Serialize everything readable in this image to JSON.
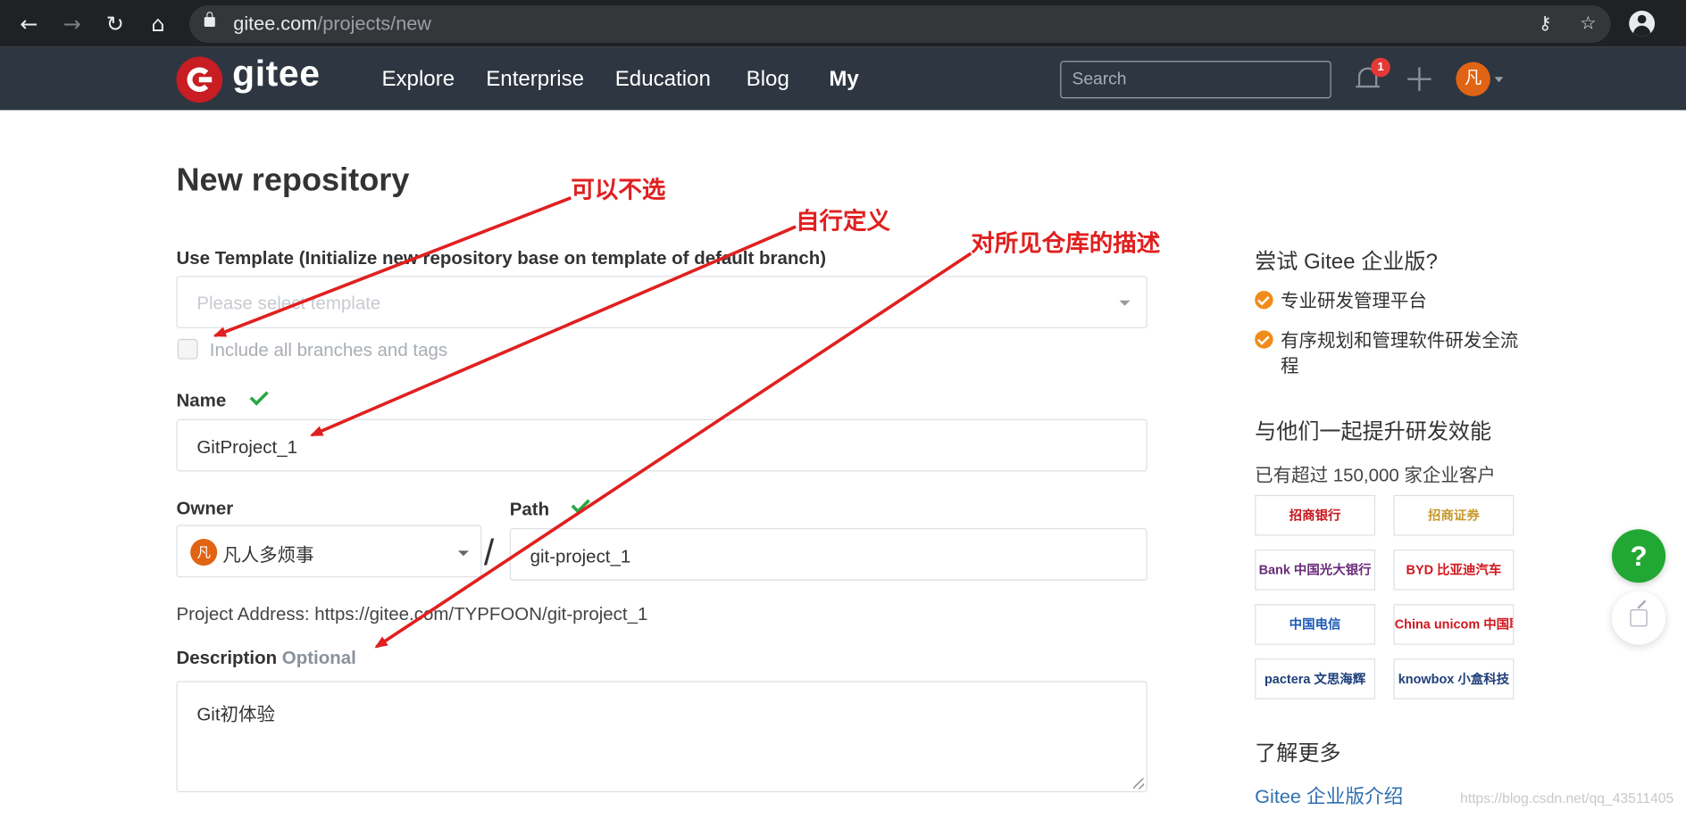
{
  "browser": {
    "url_domain": "gitee.com",
    "url_path": "/projects/new",
    "back_icon": "arrow-left",
    "forward_icon": "arrow-right",
    "reload_icon": "refresh",
    "home_icon": "home",
    "key_icon": "key",
    "star_icon": "star",
    "profile_icon": "account-circle"
  },
  "header": {
    "logo": "gitee",
    "nav": [
      "Explore",
      "Enterprise",
      "Education",
      "Blog",
      "My"
    ],
    "search_placeholder": "Search",
    "notification_count": "1",
    "avatar_char": "凡"
  },
  "form": {
    "title": "New repository",
    "template_label": "Use Template (Initialize new repository base on template of default branch)",
    "template_placeholder": "Please select template",
    "include_branches": "Include all branches and tags",
    "name_label": "Name",
    "name_value": "GitProject_1",
    "owner_label": "Owner",
    "owner_value": "凡人多烦事",
    "owner_avatar": "凡",
    "path_label": "Path",
    "path_value": "git-project_1",
    "address": "Project Address: https://gitee.com/TYPFOON/git-project_1",
    "description_label": "Description",
    "description_optional": "Optional",
    "description_value": "Git初体验"
  },
  "annotations": {
    "optional_note": "可以不选",
    "custom_note": "自行定义",
    "description_note": "对所见仓库的描述",
    "color": "#e02020"
  },
  "sidebar": {
    "heading1": "尝试 Gitee 企业版?",
    "items": [
      "专业研发管理平台",
      "有序规划和管理软件研发全流程"
    ],
    "heading2": "与他们一起提升研发效能",
    "subtext": "已有超过 150,000 家企业客户",
    "clients": [
      "招商银行",
      "招商证券",
      "Bank 中国光大银行",
      "BYD 比亚迪汽车",
      "中国电信",
      "China unicom 中国联通",
      "pactera 文思海辉",
      "knowbox 小盒科技"
    ],
    "heading3": "了解更多",
    "link": "Gitee 企业版介绍"
  },
  "floating": {
    "help": "?",
    "share_icon": "share"
  },
  "watermark": "https://blog.csdn.net/qq_43511405",
  "colors": {
    "header_bg": "#2d3641",
    "brand_red": "#c71d23",
    "success_green": "#28a745",
    "help_green": "#21a834",
    "accent_orange": "#f08c1c"
  }
}
